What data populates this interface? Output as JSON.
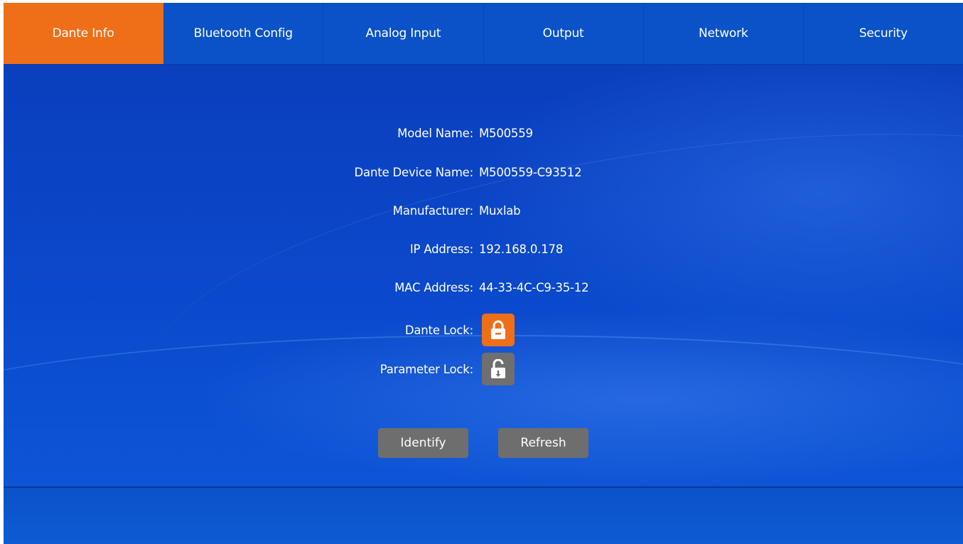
{
  "tabs": [
    {
      "label": "Dante Info",
      "active": true
    },
    {
      "label": "Bluetooth Config",
      "active": false
    },
    {
      "label": "Analog Input",
      "active": false
    },
    {
      "label": "Output",
      "active": false
    },
    {
      "label": "Network",
      "active": false
    },
    {
      "label": "Security",
      "active": false
    }
  ],
  "info": {
    "model_name": {
      "label": "Model Name:",
      "value": "M500559"
    },
    "device_name": {
      "label": "Dante Device Name:",
      "value": "M500559-C93512"
    },
    "manufacturer": {
      "label": "Manufacturer:",
      "value": "Muxlab"
    },
    "ip_address": {
      "label": "IP Address:",
      "value": "192.168.0.178"
    },
    "mac_address": {
      "label": "MAC Address:",
      "value": "44-33-4C-C9-35-12"
    }
  },
  "locks": {
    "dante_lock": {
      "label": "Dante Lock:",
      "state": "locked",
      "icon": "lock-closed-icon"
    },
    "parameter_lock": {
      "label": "Parameter Lock:",
      "state": "unlocked",
      "icon": "lock-open-icon"
    }
  },
  "buttons": {
    "identify": "Identify",
    "refresh": "Refresh"
  },
  "colors": {
    "accent_orange": "#ef6f19",
    "tab_blue": "#0b52c8",
    "button_gray": "#6e6e6e"
  }
}
